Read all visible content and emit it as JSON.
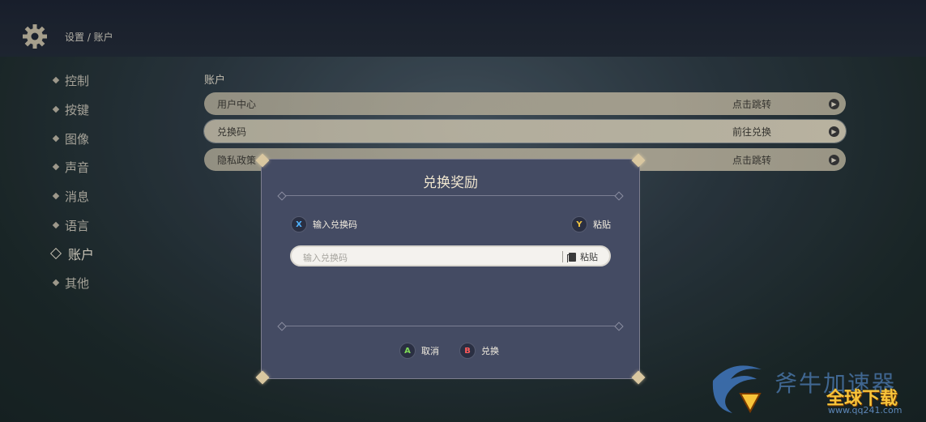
{
  "header": {
    "breadcrumb": "设置 / 账户"
  },
  "sidebar": {
    "items": [
      {
        "label": "控制"
      },
      {
        "label": "按键"
      },
      {
        "label": "图像"
      },
      {
        "label": "声音"
      },
      {
        "label": "消息"
      },
      {
        "label": "语言"
      },
      {
        "label": "账户",
        "active": true
      },
      {
        "label": "其他"
      }
    ]
  },
  "account": {
    "section_title": "账户",
    "rows": [
      {
        "label": "用户中心",
        "action": "点击跳转"
      },
      {
        "label": "兑换码",
        "action": "前往兑换"
      },
      {
        "label": "隐私政策",
        "action": "点击跳转"
      }
    ]
  },
  "dialog": {
    "title": "兑换奖励",
    "hint_input_button": "X",
    "hint_input_label": "输入兑换码",
    "hint_paste_button": "Y",
    "hint_paste_label": "粘贴",
    "input_placeholder": "输入兑换码",
    "paste_label": "粘贴",
    "cancel_button": "A",
    "cancel_label": "取消",
    "redeem_button": "B",
    "redeem_label": "兑换"
  },
  "watermark": {
    "line1": "斧牛加速器",
    "line2": "全球下载",
    "line3": "www.qq241.com"
  },
  "colors": {
    "accent_gold": "#d9c7a0",
    "dialog_bg": "#444b63",
    "x_blue": "#4fb3ff",
    "y_yellow": "#f2c640",
    "a_green": "#7ed957",
    "b_red": "#ff5a5a"
  }
}
